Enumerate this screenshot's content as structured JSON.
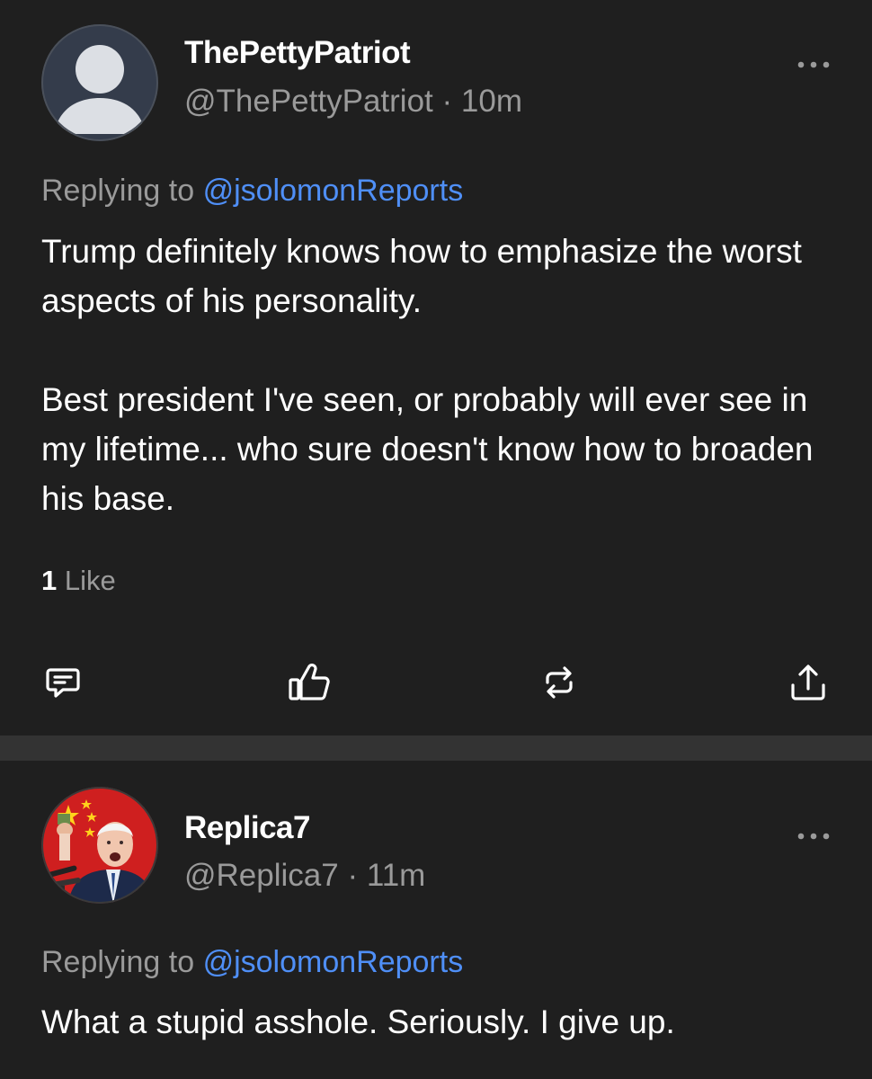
{
  "colors": {
    "background": "#1f1f1f",
    "divider": "#333333",
    "text_primary": "#ffffff",
    "text_secondary": "#9a9a9a",
    "accent_link": "#4f8ff7"
  },
  "posts": [
    {
      "display_name": "ThePettyPatriot",
      "handle": "@ThePettyPatriot",
      "separator": "·",
      "time": "10m",
      "replying_prefix": "Replying to",
      "replying_to": "@jsolomonReports",
      "body_paragraphs": [
        "Trump definitely knows how to emphasize the worst aspects of his personality.",
        "Best president I've seen, or probably will ever see in my lifetime... who sure doesn't know how to broaden his base."
      ],
      "likes_count": "1",
      "likes_label": "Like",
      "avatar_icon": "default-user-avatar-icon",
      "more_icon": "more-options-icon",
      "actions": [
        {
          "name": "comment-icon"
        },
        {
          "name": "like-icon"
        },
        {
          "name": "repost-icon"
        },
        {
          "name": "share-icon"
        }
      ]
    },
    {
      "display_name": "Replica7",
      "handle": "@Replica7",
      "separator": "·",
      "time": "11m",
      "replying_prefix": "Replying to",
      "replying_to": "@jsolomonReports",
      "body_paragraphs": [
        "What a stupid asshole. Seriously. I give up."
      ],
      "avatar_icon": "profile-photo-avatar",
      "more_icon": "more-options-icon"
    }
  ]
}
